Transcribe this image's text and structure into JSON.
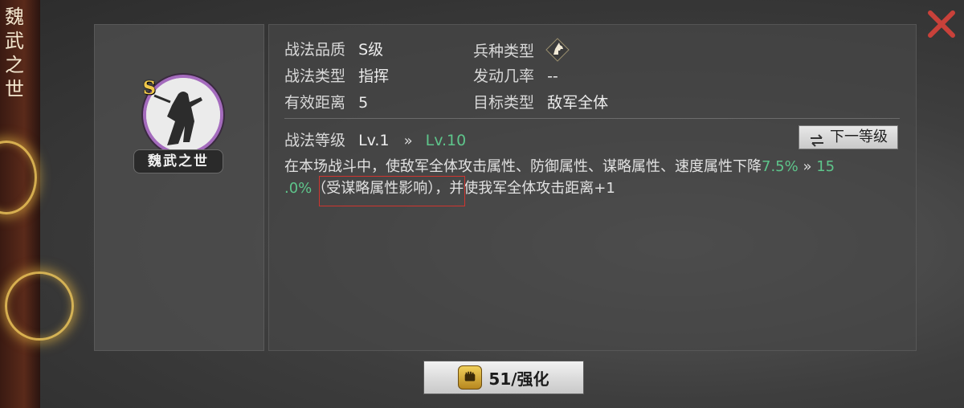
{
  "side": {
    "title_chars": [
      "魏",
      "武",
      "之",
      "世"
    ]
  },
  "tactic": {
    "grade_letter": "S",
    "name": "魏武之世"
  },
  "attributes": {
    "quality_label": "战法品质",
    "quality_value": "S级",
    "unit_label": "兵种类型",
    "type_label": "战法类型",
    "type_value": "指挥",
    "rate_label": "发动几率",
    "rate_value": "--",
    "range_label": "有效距离",
    "range_value": "5",
    "target_label": "目标类型",
    "target_value": "敌军全体"
  },
  "level": {
    "label": "战法等级",
    "current": "Lv.1",
    "arrow": "»",
    "max": "Lv.10",
    "next_button": "下一等级"
  },
  "description": {
    "part1": "在本场战斗中，使敌军全体攻击属性、防御属性、谋略属性、速度属性下降",
    "value_from": "7.5%",
    "arrow": "»",
    "value_to_a": "15",
    "value_to_b": ".0%",
    "part2": "（受谋略属性影响），并使我军全体攻击距离+1"
  },
  "enhance": {
    "label": "51/强化"
  },
  "icons": {
    "unit_icon": "horse-head-icon",
    "close_icon": "close-icon",
    "swap_icon": "swap-arrows-icon",
    "enhance_icon": "fist-icon"
  },
  "colors": {
    "accent_green": "#5ec58b",
    "close_red": "#c9413a",
    "portrait_ring": "#a46bbd",
    "grade_gold": "#f0c84a"
  }
}
